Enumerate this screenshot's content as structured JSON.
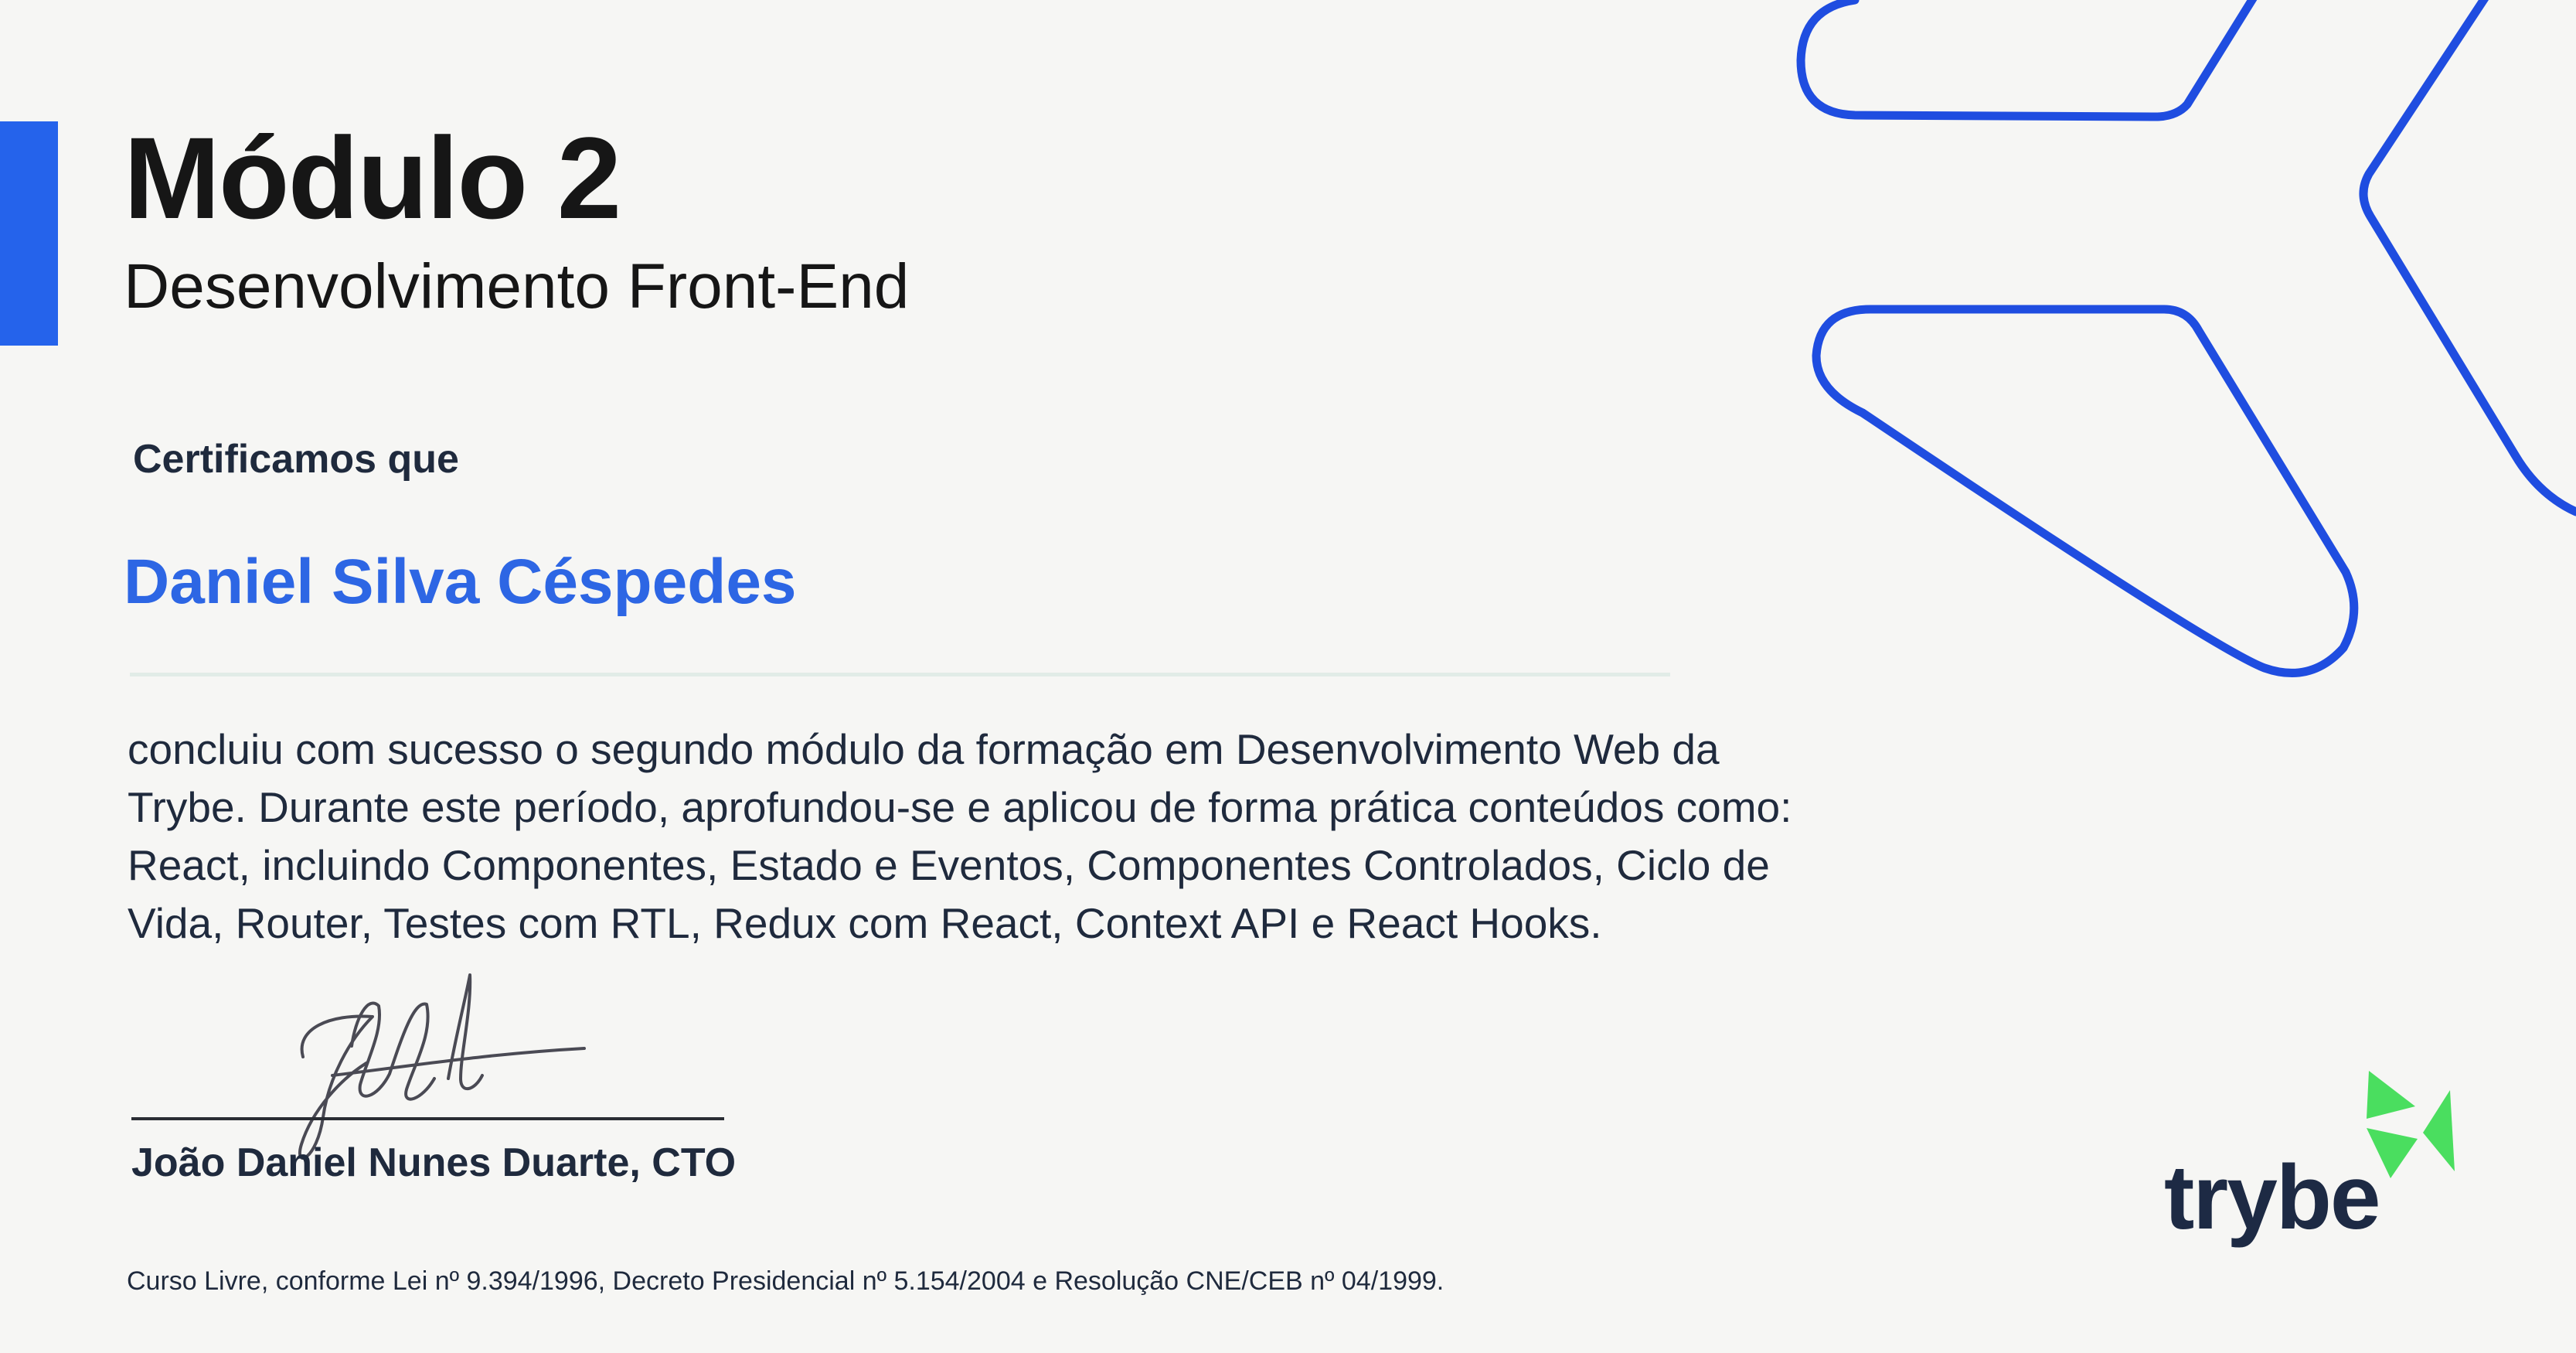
{
  "module": {
    "title": "Módulo 2",
    "subtitle": "Desenvolvimento Front-End"
  },
  "certificate": {
    "label": "Certificamos que",
    "recipient": "Daniel Silva Céspedes",
    "body_lines": [
      "concluiu com sucesso o segundo módulo da formação em Desenvolvimento Web da",
      "Trybe. Durante este período, aprofundou-se e aplicou de forma prática conteúdos como:",
      "React, incluindo Componentes, Estado e Eventos, Componentes Controlados, Ciclo de",
      "Vida, Router, Testes com RTL, Redux com React, Context API e React Hooks."
    ]
  },
  "signature": {
    "signer": "João Daniel Nunes Duarte, CTO"
  },
  "legal": {
    "text": "Curso Livre, conforme Lei nº 9.394/1996, Decreto Presidencial nº 5.154/2004 e Resolução CNE/CEB nº 04/1999."
  },
  "brand": {
    "wordmark": "trybe",
    "symbol_icon": "trybe-arrow-icon",
    "decorative_icon": "outline-arrow-icon"
  },
  "colors": {
    "accent": "#2563eb",
    "recipient": "#2d66e4",
    "outline": "#1f4de0",
    "brand_green": "#4ade5f",
    "brand_text": "#1d2a44"
  }
}
